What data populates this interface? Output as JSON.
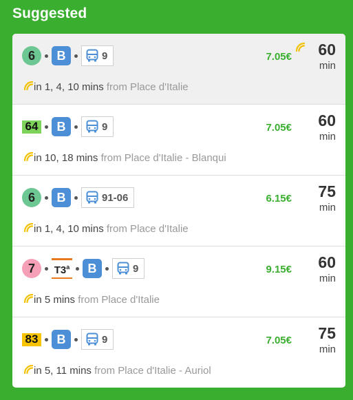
{
  "heading": "Suggested",
  "colors": {
    "background": "#3aae2f",
    "price": "#3aae2f",
    "realtime": "#f2c100",
    "bus_mode": "#4c8fd6",
    "tram_bar": "#e8791c"
  },
  "icons": {
    "realtime": "realtime-signal-icon",
    "bus": "bus-icon"
  },
  "routes": [
    {
      "line": "6",
      "line_color": "#6cc792",
      "mode": "B",
      "bus": "9",
      "price": "7.05€",
      "duration": "60",
      "unit": "min",
      "times": "in 1, 4, 10 mins",
      "from": "from Place d'Italie",
      "realtime_duration": true
    },
    {
      "line": "64",
      "line_color": "#7ed35a",
      "mode": "B",
      "bus": "9",
      "price": "7.05€",
      "duration": "60",
      "unit": "min",
      "times": "in 10, 18 mins",
      "from": "from Place d'Italie - Blanqui"
    },
    {
      "line": "6",
      "line_color": "#6cc792",
      "mode": "B",
      "bus": "91-06",
      "price": "6.15€",
      "duration": "75",
      "unit": "min",
      "times": "in 1, 4, 10 mins",
      "from": "from Place d'Italie"
    },
    {
      "line": "7",
      "line_color": "#f5a0b6",
      "tram": "T3",
      "tram_sup": "a",
      "mode": "B",
      "bus": "9",
      "price": "9.15€",
      "duration": "60",
      "unit": "min",
      "times": "in 5 mins",
      "from": "from Place d'Italie"
    },
    {
      "line": "83",
      "line_color": "#f8c400",
      "mode": "B",
      "bus": "9",
      "price": "7.05€",
      "duration": "75",
      "unit": "min",
      "times": "in 5, 11 mins",
      "from": "from Place d'Italie - Auriol"
    }
  ]
}
